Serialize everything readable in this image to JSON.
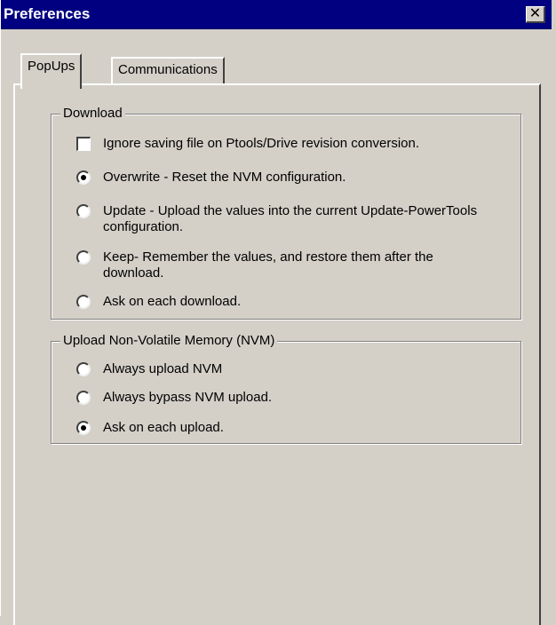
{
  "window": {
    "title": "Preferences",
    "close_label": "✕"
  },
  "tabs": [
    {
      "label": "PopUps",
      "active": true
    },
    {
      "label": "Communications",
      "active": false
    }
  ],
  "download": {
    "legend": "Download",
    "ignore_checkbox": {
      "label": "Ignore saving file on Ptools/Drive revision conversion.",
      "checked": false
    },
    "options": [
      {
        "label": "Overwrite - Reset the NVM configuration.",
        "selected": true
      },
      {
        "label": "Update - Upload the values into the current Update-PowerTools configuration.",
        "selected": false
      },
      {
        "label": "Keep- Remember the values, and restore them after the download.",
        "selected": false
      },
      {
        "label": "Ask on each download.",
        "selected": false
      }
    ]
  },
  "upload": {
    "legend": "Upload Non-Volatile Memory (NVM)",
    "options": [
      {
        "label": "Always upload NVM",
        "selected": false
      },
      {
        "label": "Always bypass NVM upload.",
        "selected": false
      },
      {
        "label": "Ask on each upload.",
        "selected": true
      }
    ]
  }
}
